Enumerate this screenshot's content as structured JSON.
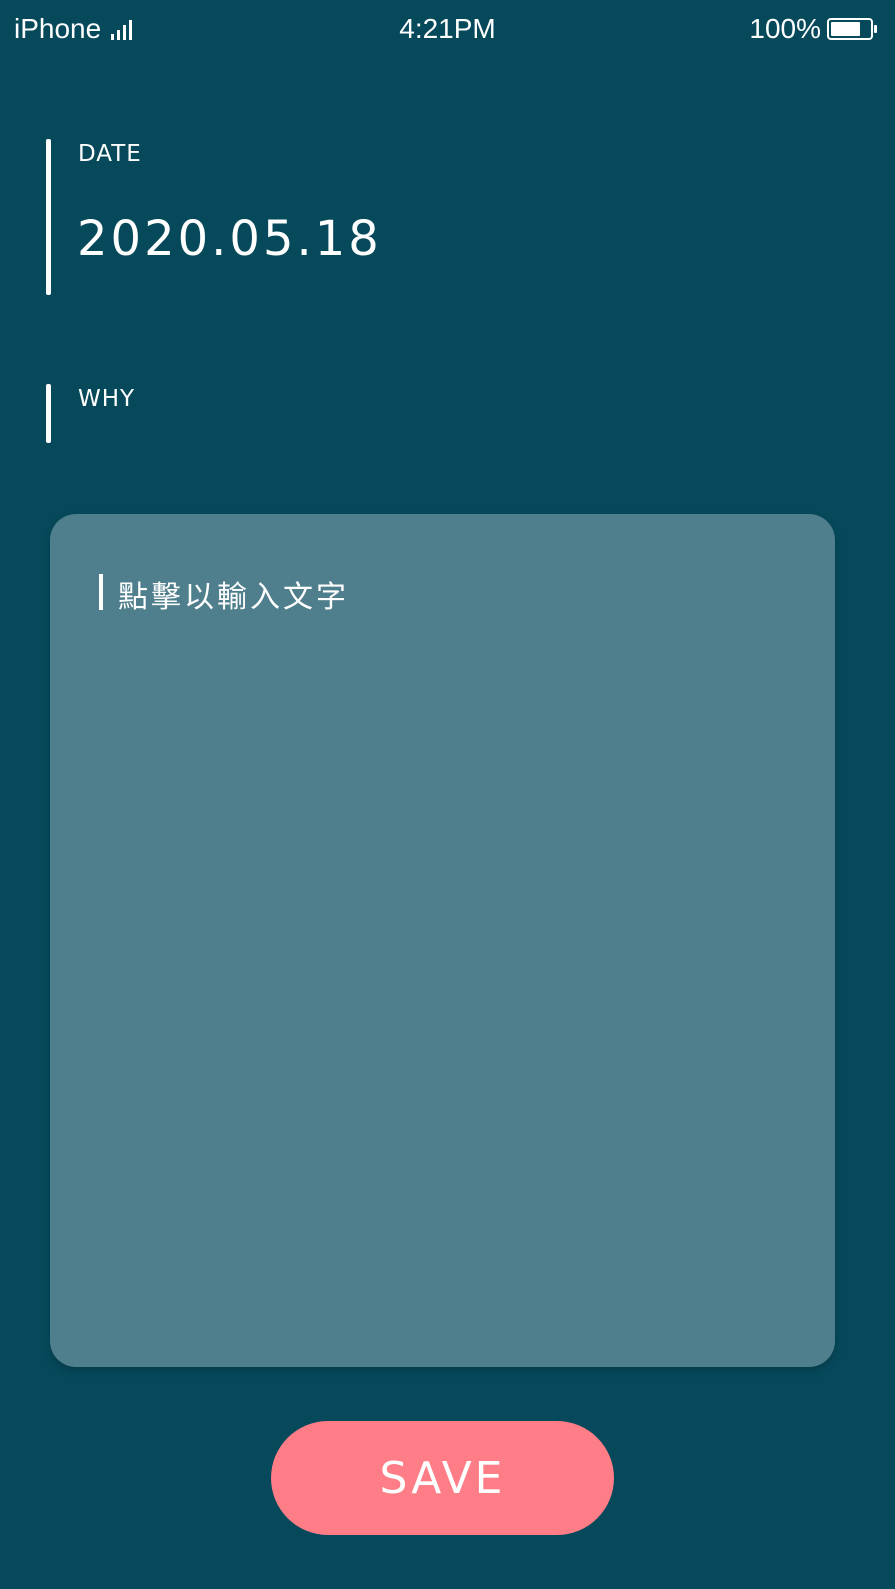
{
  "status_bar": {
    "carrier": "iPhone",
    "time": "4:21PM",
    "battery_percent": "100%",
    "signal_icon": "signal-bars-icon",
    "battery_icon": "battery-full-icon"
  },
  "date_field": {
    "label": "DATE",
    "value": "2020.05.18"
  },
  "why_field": {
    "label": "WHY"
  },
  "text_area": {
    "placeholder": "點擊以輸入文字",
    "value": ""
  },
  "save_button": {
    "label": "SAVE"
  },
  "colors": {
    "background": "#06495b",
    "card": "#4f7f8c",
    "accent": "#ff7d86",
    "text": "#ffffff"
  }
}
